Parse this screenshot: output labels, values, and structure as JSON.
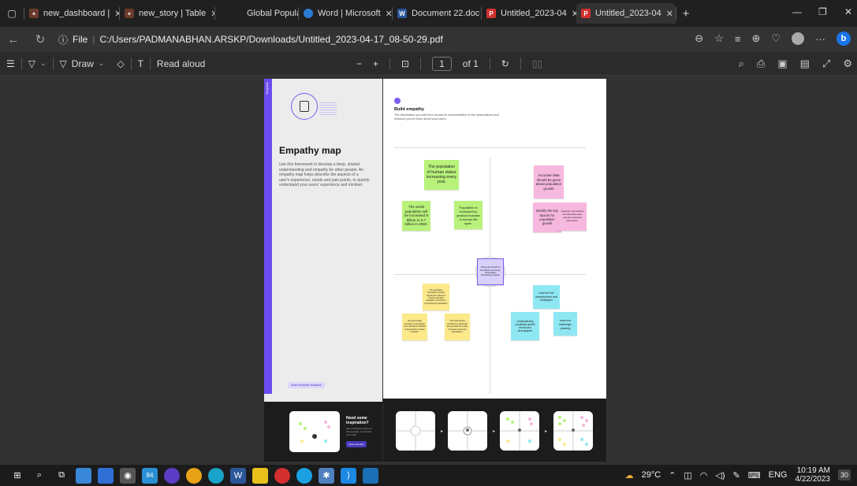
{
  "tabs": [
    {
      "label": "new_dashboard |",
      "active": false
    },
    {
      "label": "new_story | Table",
      "active": false
    },
    {
      "label": "Global Population",
      "active": false
    },
    {
      "label": "Word | Microsoft",
      "active": false
    },
    {
      "label": "Document 22.doc",
      "active": false
    },
    {
      "label": "Untitled_2023-04",
      "active": false
    },
    {
      "label": "Untitled_2023-04",
      "active": true
    }
  ],
  "address": {
    "scheme_label": "File",
    "url": "C:/Users/PADMANABHAN.ARSKP/Downloads/Untitled_2023-04-17_08-50-29.pdf"
  },
  "pdf_toolbar": {
    "draw_label": "Draw",
    "read_aloud_label": "Read aloud",
    "zoom_out": "−",
    "zoom_in": "+",
    "page_number": "1",
    "page_total": "of 1"
  },
  "page_left": {
    "template_label": "Template",
    "title": "Empathy map",
    "description": "Use this framework to develop a deep, shared understanding and empathy for other people. An empathy map helps describe the aspects of a user's experience, needs and pain points, to quickly understand your users' experience and mindset.",
    "feedback_label": "Share template feedback",
    "inspo_title": "Need some inspiration?",
    "inspo_sub": "See a finished version of this template to kickstart your work",
    "inspo_button": "Open example"
  },
  "page_right": {
    "title": "Build empathy",
    "description": "The information you add here should be representative of the observations and research you've done about your users.",
    "stickies": [
      {
        "text": "The population of human status increasing every year.",
        "color": "green"
      },
      {
        "text": "The world population will be increased 8 billion to 9.7 billion in 2050.",
        "color": "green"
      },
      {
        "text": "Population is increased by gradual increase in human life span.",
        "color": "green"
      },
      {
        "text": "Accurate data should be given about population growth",
        "color": "pink"
      },
      {
        "text": "Identify the key factors for population growth",
        "color": "pink"
      },
      {
        "text": "Integrate and analyze the data with other relevant business information.",
        "color": "pink"
      },
      {
        "text": "Tracing the Growth of the Global Community: A Population Forecasting Analysis",
        "color": "center"
      },
      {
        "text": "The population forecasting method targets the values of present and past population records for computing the calculation.",
        "color": "yellow"
      },
      {
        "text": "the percentage increase in population from decade to decade is assumed to remain constant.",
        "color": "yellow"
      },
      {
        "text": "The book shows records of a particular area provide the value of present and past populations.",
        "color": "yellow"
      },
      {
        "text": "Improve the infrastructure and strategies",
        "color": "cyan"
      },
      {
        "text": "Understanding population growth trends and demographic",
        "color": "cyan"
      },
      {
        "text": "Improve startergic planing",
        "color": "cyan"
      }
    ]
  },
  "taskbar": {
    "temperature": "29°C",
    "language": "ENG",
    "time": "10:19 AM",
    "date": "4/22/2023",
    "badge": "84",
    "notif": "30"
  },
  "colors": {
    "accent": "#6b4bf0",
    "sticky_green": "#b8f27a",
    "sticky_pink": "#f7b8df",
    "sticky_yellow": "#fbe98a",
    "sticky_cyan": "#8ee8f3"
  }
}
